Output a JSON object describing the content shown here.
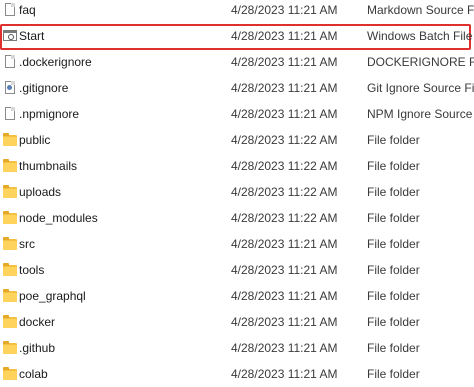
{
  "files": [
    {
      "name": "faq",
      "modified": "4/28/2023 11:21 AM",
      "type": "Markdown Source File",
      "icon": "markdown-file-icon",
      "kind": "doc"
    },
    {
      "name": "Start",
      "modified": "4/28/2023 11:21 AM",
      "type": "Windows Batch File",
      "icon": "batch-file-icon",
      "kind": "bat",
      "selected": true
    },
    {
      "name": ".dockerignore",
      "modified": "4/28/2023 11:21 AM",
      "type": "DOCKERIGNORE File",
      "icon": "blank-file-icon",
      "kind": "doc"
    },
    {
      "name": ".gitignore",
      "modified": "4/28/2023 11:21 AM",
      "type": "Git Ignore Source File",
      "icon": "git-file-icon",
      "kind": "docmark"
    },
    {
      "name": ".npmignore",
      "modified": "4/28/2023 11:21 AM",
      "type": "NPM Ignore Source File",
      "icon": "blank-file-icon",
      "kind": "doc"
    },
    {
      "name": "public",
      "modified": "4/28/2023 11:22 AM",
      "type": "File folder",
      "icon": "folder-icon",
      "kind": "folder"
    },
    {
      "name": "thumbnails",
      "modified": "4/28/2023 11:22 AM",
      "type": "File folder",
      "icon": "folder-icon",
      "kind": "folder"
    },
    {
      "name": "uploads",
      "modified": "4/28/2023 11:22 AM",
      "type": "File folder",
      "icon": "folder-icon",
      "kind": "folder"
    },
    {
      "name": "node_modules",
      "modified": "4/28/2023 11:22 AM",
      "type": "File folder",
      "icon": "folder-icon",
      "kind": "folder"
    },
    {
      "name": "src",
      "modified": "4/28/2023 11:21 AM",
      "type": "File folder",
      "icon": "folder-icon",
      "kind": "folder"
    },
    {
      "name": "tools",
      "modified": "4/28/2023 11:21 AM",
      "type": "File folder",
      "icon": "folder-icon",
      "kind": "folder"
    },
    {
      "name": "poe_graphql",
      "modified": "4/28/2023 11:21 AM",
      "type": "File folder",
      "icon": "folder-icon",
      "kind": "folder"
    },
    {
      "name": "docker",
      "modified": "4/28/2023 11:21 AM",
      "type": "File folder",
      "icon": "folder-icon",
      "kind": "folder"
    },
    {
      "name": ".github",
      "modified": "4/28/2023 11:21 AM",
      "type": "File folder",
      "icon": "folder-icon",
      "kind": "folder"
    },
    {
      "name": "colab",
      "modified": "4/28/2023 11:21 AM",
      "type": "File folder",
      "icon": "folder-icon",
      "kind": "folder"
    }
  ],
  "colors": {
    "selection_border": "#e0302e",
    "folder": "#ffd35c"
  }
}
